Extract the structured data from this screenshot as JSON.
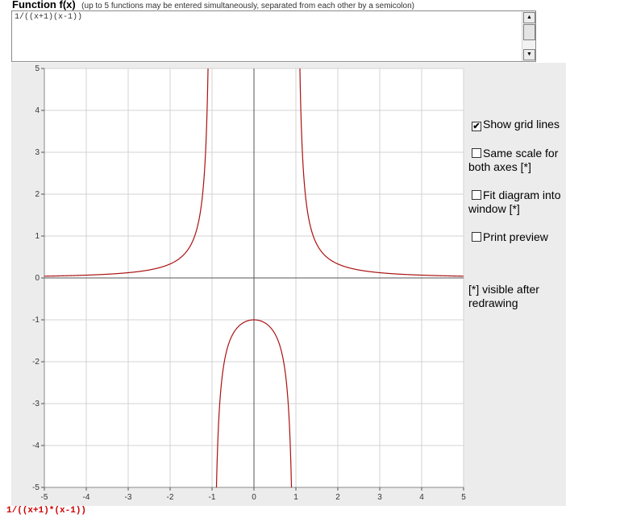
{
  "header": {
    "title": "Function f(x)",
    "hint": "(up to 5 functions may be entered simultaneously, separated from each other by a semicolon)"
  },
  "input": {
    "value": "1/((x+1)(x-1))"
  },
  "scrollbar": {
    "up_icon": "arrow-up-icon",
    "down_icon": "arrow-down-icon"
  },
  "options": {
    "grid": {
      "label": "Show grid lines",
      "checked": true
    },
    "same_scale": {
      "label": "Same scale for both axes [*]",
      "checked": false
    },
    "fit": {
      "label": "Fit diagram into window [*]",
      "checked": false
    },
    "print": {
      "label": "Print preview",
      "checked": false
    },
    "note": "[*] visible after redrawing"
  },
  "legend": {
    "label": "1/((x+1)*(x-1))"
  },
  "colors": {
    "curve": "#aa1111",
    "grid": "#d3d3d3",
    "axis": "#555555",
    "background": "#ececec"
  },
  "chart_data": {
    "type": "line",
    "function": "1/((x+1)(x-1))",
    "xlim": [
      -5,
      5
    ],
    "ylim": [
      -5,
      5
    ],
    "xticks": [
      -5,
      -4,
      -3,
      -2,
      -1,
      0,
      1,
      2,
      3,
      4,
      5
    ],
    "yticks": [
      -5,
      -4,
      -3,
      -2,
      -1,
      0,
      1,
      2,
      3,
      4,
      5
    ],
    "grid": true,
    "vertical_asymptotes": [
      -1,
      1
    ],
    "series": [
      {
        "name": "1/((x+1)*(x-1))",
        "x": [
          -5,
          -4,
          -3,
          -2,
          -1.5,
          -1.2,
          -1.1,
          -1.05,
          -0.95,
          -0.9,
          -0.7,
          -0.5,
          -0.3,
          0,
          0.3,
          0.5,
          0.7,
          0.9,
          0.95,
          1.05,
          1.1,
          1.2,
          1.5,
          2,
          3,
          4,
          5
        ],
        "y": [
          0.0417,
          0.0667,
          0.125,
          0.333,
          0.8,
          2.27,
          4.76,
          9.76,
          -10.26,
          -5.26,
          -1.96,
          -1.333,
          -1.099,
          -1,
          -1.099,
          -1.333,
          -1.96,
          -5.26,
          -10.26,
          9.76,
          4.76,
          2.27,
          0.8,
          0.333,
          0.125,
          0.0667,
          0.0417
        ]
      }
    ]
  }
}
